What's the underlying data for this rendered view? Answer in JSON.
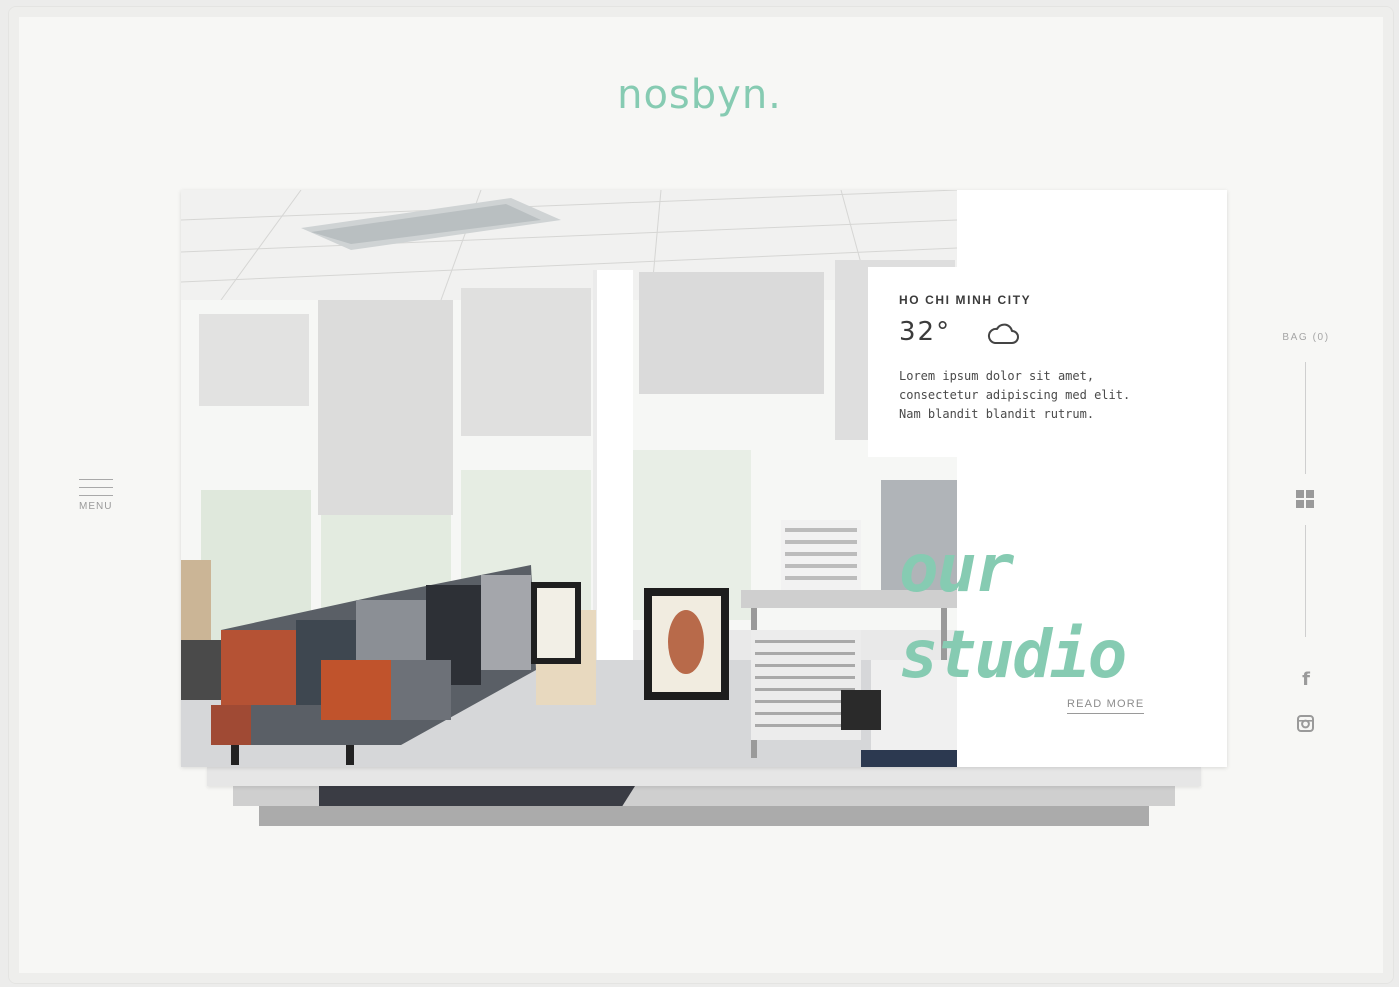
{
  "brand": {
    "logo": "nosbyn.",
    "accent_color": "#86cbb2"
  },
  "nav": {
    "menu_label": "MENU",
    "bag_label": "BAG (0)"
  },
  "weather": {
    "city": "HO CHI MINH CITY",
    "temperature": "32°",
    "condition_icon": "cloud-icon",
    "description": "Lorem ipsum dolor sit amet, consectetur adipiscing med elit. Nam blandit blandit rutrum."
  },
  "feature": {
    "headline_line1": "our",
    "headline_line2": "studio",
    "read_more_label": "READ MORE"
  },
  "social": {
    "facebook_icon": "facebook-icon",
    "instagram_icon": "instagram-icon"
  }
}
